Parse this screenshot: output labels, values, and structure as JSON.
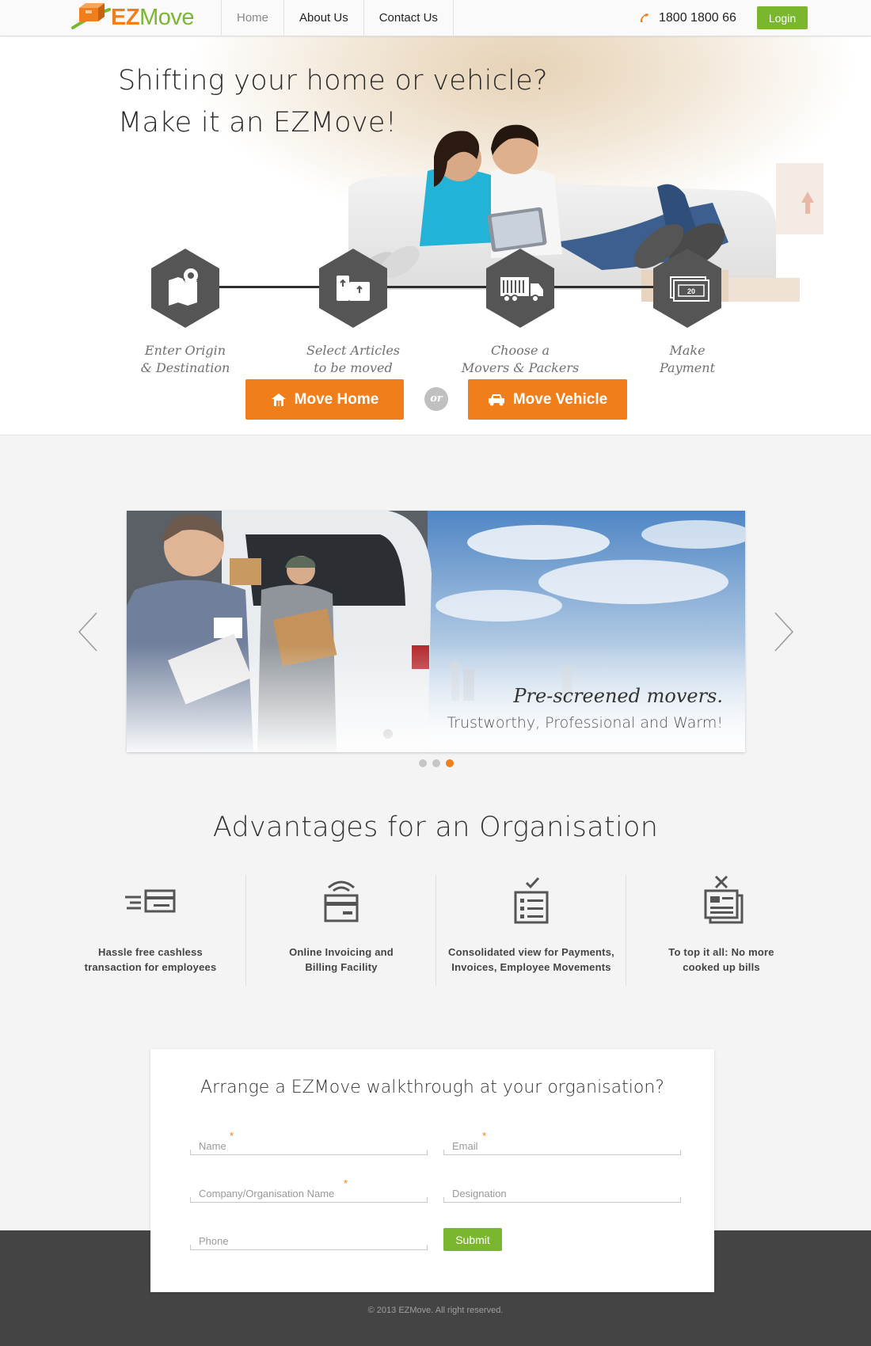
{
  "brand": {
    "name_part1": "EZ",
    "name_part2": "Move",
    "orange": "#f07e1b",
    "green": "#7ab72f"
  },
  "nav": {
    "items": [
      {
        "label": "Home",
        "active": true
      },
      {
        "label": "About Us"
      },
      {
        "label": "Contact Us"
      }
    ]
  },
  "header": {
    "phone": "1800 1800 66",
    "login_label": "Login"
  },
  "hero": {
    "title_line1": "Shifting your home or vehicle?",
    "title_line2": "Make it an EZMove!",
    "steps": [
      {
        "line1": "Enter Origin",
        "line2": "& Destination",
        "icon": "map-pin-icon"
      },
      {
        "line1": "Select Articles",
        "line2": "to be moved",
        "icon": "boxes-icon"
      },
      {
        "line1": "Choose a",
        "line2": "Movers & Packers",
        "icon": "truck-icon"
      },
      {
        "line1": "Make",
        "line2": "Payment",
        "icon": "payment-icon"
      }
    ],
    "move_home_label": "Move Home",
    "or_label": "or",
    "move_vehicle_label": "Move Vehicle"
  },
  "slider": {
    "caption_title": "Pre-screened movers.",
    "caption_subtitle": "Trustworthy, Professional and Warm!",
    "slide_count": 3,
    "active_slide": 3
  },
  "advantages": {
    "title": "Advantages for an Organisation",
    "items": [
      {
        "line1": "Hassle free cashless",
        "line2": "transaction for employees",
        "icon": "cashless-card-icon"
      },
      {
        "line1": "Online Invoicing and",
        "line2": "Billing Facility",
        "icon": "online-invoice-icon"
      },
      {
        "line1": "Consolidated view for Payments,",
        "line2": "Invoices, Employee Movements",
        "icon": "checklist-icon"
      },
      {
        "line1": "To top it all: No more",
        "line2": "cooked up bills",
        "icon": "no-bills-icon"
      }
    ]
  },
  "form": {
    "title": "Arrange a EZMove walkthrough at your organisation?",
    "name_placeholder": "Name",
    "email_placeholder": "Email",
    "company_placeholder": "Company/Organisation Name",
    "designation_placeholder": "Designation",
    "phone_placeholder": "Phone",
    "required_mark": "*",
    "submit_label": "Submit"
  },
  "footer": {
    "copyright": "© 2013 EZMove. All right reserved."
  }
}
